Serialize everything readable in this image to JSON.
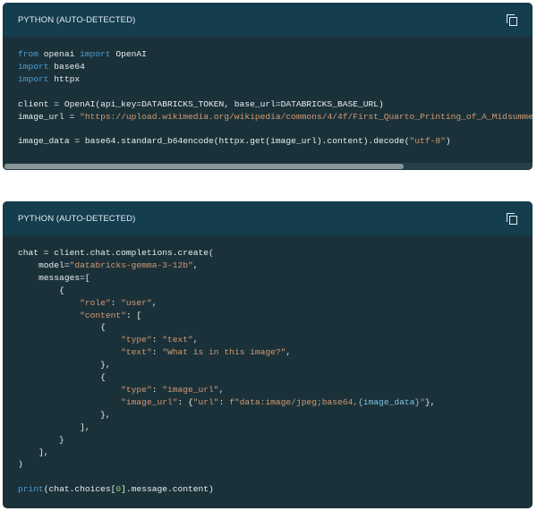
{
  "blocks": [
    {
      "language_label": "PYTHON  (AUTO-DETECTED)",
      "copy_icon": "copy-icon",
      "lines": [
        [
          [
            "kw",
            "from"
          ],
          [
            "p",
            " openai "
          ],
          [
            "kw",
            "import"
          ],
          [
            "p",
            " OpenAI"
          ]
        ],
        [
          [
            "kw",
            "import"
          ],
          [
            "p",
            " base64"
          ]
        ],
        [
          [
            "kw",
            "import"
          ],
          [
            "p",
            " httpx"
          ]
        ],
        [],
        [
          [
            "p",
            "client = OpenAI(api_key=DATABRICKS_TOKEN, base_url=DATABRICKS_BASE_URL)"
          ]
        ],
        [
          [
            "p",
            "image_url = "
          ],
          [
            "str",
            "\"https://upload.wikimedia.org/wikipedia/commons/4/4f/First_Quarto_Printing_of_A_Midsummer_Nights_Dream.jpg\""
          ]
        ],
        [],
        [
          [
            "p",
            "image_data = base64.standard_b64encode(httpx.get(image_url).content).decode("
          ],
          [
            "str",
            "\"utf-8\""
          ],
          [
            "p",
            ")"
          ]
        ]
      ]
    },
    {
      "language_label": "PYTHON  (AUTO-DETECTED)",
      "copy_icon": "copy-icon",
      "lines": [
        [
          [
            "p",
            "chat = client.chat.completions.create("
          ]
        ],
        [
          [
            "p",
            "    model="
          ],
          [
            "str",
            "\"databricks-gemma-3-12b\""
          ],
          [
            "p",
            ","
          ]
        ],
        [
          [
            "p",
            "    messages=["
          ]
        ],
        [
          [
            "p",
            "        {"
          ]
        ],
        [
          [
            "p",
            "            "
          ],
          [
            "str",
            "\"role\""
          ],
          [
            "p",
            ": "
          ],
          [
            "str",
            "\"user\""
          ],
          [
            "p",
            ","
          ]
        ],
        [
          [
            "p",
            "            "
          ],
          [
            "str",
            "\"content\""
          ],
          [
            "p",
            ": ["
          ]
        ],
        [
          [
            "p",
            "                {"
          ]
        ],
        [
          [
            "p",
            "                    "
          ],
          [
            "str",
            "\"type\""
          ],
          [
            "p",
            ": "
          ],
          [
            "str",
            "\"text\""
          ],
          [
            "p",
            ","
          ]
        ],
        [
          [
            "p",
            "                    "
          ],
          [
            "str",
            "\"text\""
          ],
          [
            "p",
            ": "
          ],
          [
            "str",
            "\"What is in this image?\""
          ],
          [
            "p",
            ","
          ]
        ],
        [
          [
            "p",
            "                },"
          ]
        ],
        [
          [
            "p",
            "                {"
          ]
        ],
        [
          [
            "p",
            "                    "
          ],
          [
            "str",
            "\"type\""
          ],
          [
            "p",
            ": "
          ],
          [
            "str",
            "\"image_url\""
          ],
          [
            "p",
            ","
          ]
        ],
        [
          [
            "p",
            "                    "
          ],
          [
            "str",
            "\"image_url\""
          ],
          [
            "p",
            ": {"
          ],
          [
            "str",
            "\"url\""
          ],
          [
            "p",
            ": "
          ],
          [
            "str",
            "f\"data:image/jpeg;base64,"
          ],
          [
            "interp",
            "{image_data}"
          ],
          [
            "str",
            "\""
          ],
          [
            "p",
            "},"
          ]
        ],
        [
          [
            "p",
            "                },"
          ]
        ],
        [
          [
            "p",
            "            ],"
          ]
        ],
        [
          [
            "p",
            "        }"
          ]
        ],
        [
          [
            "p",
            "    ],"
          ]
        ],
        [
          [
            "p",
            ")"
          ]
        ],
        [],
        [
          [
            "kw",
            "print"
          ],
          [
            "p",
            "(chat.choices["
          ],
          [
            "num",
            "0"
          ],
          [
            "p",
            "].message.content)"
          ]
        ]
      ]
    }
  ]
}
